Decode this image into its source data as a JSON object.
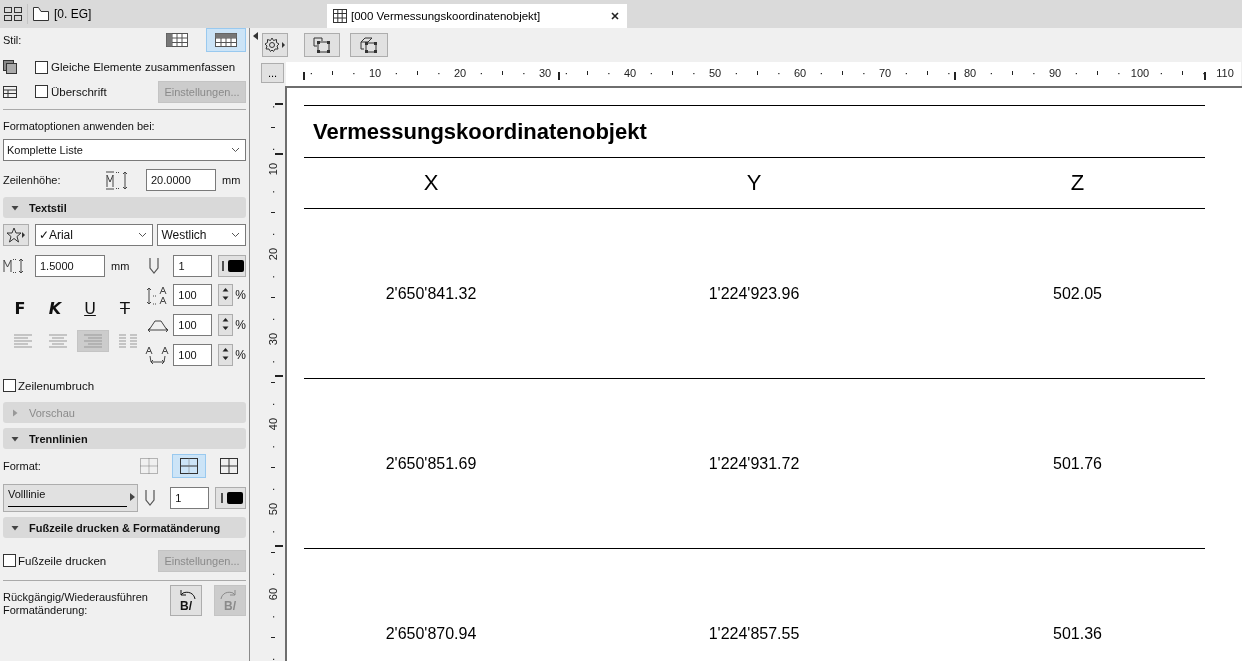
{
  "top_bar": {
    "location": "[0. EG]"
  },
  "document_tab": {
    "title": "[000 Vermessungskoordinatenobjekt]",
    "selected": true
  },
  "panel": {
    "style": {
      "label": "Stil:",
      "options": [
        {
          "selected": false
        },
        {
          "selected": true
        }
      ]
    },
    "merge": {
      "label": "Gleiche Elemente zusammenfassen",
      "checked": false
    },
    "heading": {
      "label": "Überschrift",
      "checked": false
    },
    "heading_settings": {
      "label": "Einstellungen...",
      "disabled": true
    },
    "apply": {
      "label": "Formatoptionen anwenden bei:",
      "value": "Komplette Liste"
    },
    "row_height": {
      "label": "Zeilenhöhe:",
      "value": "20.0000",
      "unit": "mm"
    },
    "text_style": {
      "title": "Textstil",
      "expanded": true,
      "font": "✓Arial",
      "script": "Westlich",
      "size": "1.5000",
      "size_unit": "mm",
      "pen": "1",
      "formats": [
        {
          "kind": "bold",
          "label": "F",
          "selected": false
        },
        {
          "kind": "italic",
          "label": "K",
          "selected": false
        },
        {
          "kind": "underline",
          "label": "U",
          "selected": false
        },
        {
          "kind": "strike",
          "label": "T",
          "selected": false
        }
      ],
      "alignments": [
        {
          "kind": "left",
          "selected": false
        },
        {
          "kind": "center",
          "selected": false
        },
        {
          "kind": "right",
          "selected": true
        },
        {
          "kind": "justify",
          "selected": false
        }
      ],
      "spacing": [
        {
          "kind": "line",
          "value": "100",
          "unit": "%"
        },
        {
          "kind": "width",
          "value": "100",
          "unit": "%"
        },
        {
          "kind": "letter",
          "value": "100",
          "unit": "%"
        }
      ]
    },
    "wrap": {
      "label": "Zeilenumbruch",
      "checked": false
    },
    "preview": {
      "title": "Vorschau",
      "expanded": false,
      "disabled": true
    },
    "separators": {
      "title": "Trennlinien",
      "expanded": true,
      "format_label": "Format:",
      "formats": [
        {
          "kind": "none",
          "selected": false
        },
        {
          "kind": "horizontal",
          "selected": true
        },
        {
          "kind": "all",
          "selected": false
        }
      ],
      "line_type": "Volllinie",
      "pen": "1"
    },
    "footer": {
      "title": "Fußzeile drucken & Formatänderung",
      "expanded": true,
      "print": {
        "label": "Fußzeile drucken",
        "checked": false
      },
      "settings": {
        "label": "Einstellungen...",
        "disabled": true
      },
      "undo_label": "Rückgängig/Wiederausführen Formatänderung:",
      "undo": {
        "label": "B/",
        "disabled": false
      },
      "redo": {
        "label": "B/",
        "disabled": true
      }
    }
  },
  "rulers": {
    "corner": "...",
    "horizontal": [
      "10",
      "20",
      "30",
      "40",
      "50",
      "60",
      "70",
      "80",
      "90",
      "100",
      "110"
    ],
    "vertical": [
      "10",
      "20",
      "30",
      "40",
      "50",
      "60"
    ]
  },
  "schedule": {
    "title": "Vermessungskoordinatenobjekt",
    "columns": [
      "X",
      "Y",
      "Z"
    ],
    "rows": [
      [
        "2'650'841.32",
        "1'224'923.96",
        "502.05"
      ],
      [
        "2'650'851.69",
        "1'224'931.72",
        "501.76"
      ],
      [
        "2'650'870.94",
        "1'224'857.55",
        "501.36"
      ]
    ]
  }
}
